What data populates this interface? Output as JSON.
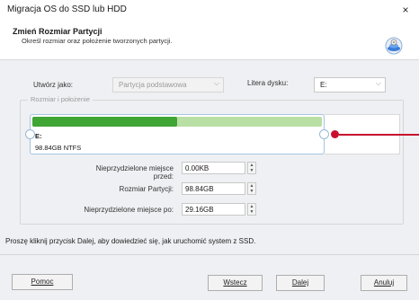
{
  "window": {
    "title": "Migracja OS do SSD lub HDD",
    "close_label": "×"
  },
  "header": {
    "title": "Zmień Rozmiar Partycji",
    "subtitle": "Określ rozmiar oraz położenie tworzonych partycji."
  },
  "form": {
    "create_as_label": "Utwórz jako:",
    "create_as_value": "Partycja podstawowa",
    "drive_letter_label": "Litera dysku:",
    "drive_letter_value": "E:"
  },
  "group": {
    "legend": "Rozmiar i położenie"
  },
  "partition": {
    "name": "E:",
    "info": "98.84GB NTFS",
    "used_fraction": 0.5,
    "bar_colors": {
      "used": "#3fa535",
      "free": "#b8dfa4"
    }
  },
  "fields": {
    "unalloc_before_label": "Nieprzydzielone miejsce przed:",
    "unalloc_before_value": "0.00KB",
    "partition_size_label": "Rozmiar Partycji:",
    "partition_size_value": "98.84GB",
    "unalloc_after_label": "Nieprzydzielone miejsce po:",
    "unalloc_after_value": "29.16GB"
  },
  "info_text": "Proszę kliknij przycisk Dalej, aby dowiedzieć się, jak uruchomić system z SSD.",
  "buttons": {
    "help": "Pomoc",
    "back": "Wstecz",
    "next": "Dalej",
    "cancel": "Anuluj"
  },
  "colors": {
    "accent_red": "#c8102e"
  }
}
